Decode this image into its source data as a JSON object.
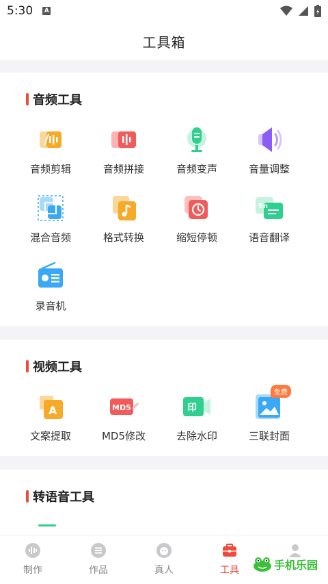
{
  "status": {
    "time": "5:30",
    "indicator": "A"
  },
  "header": {
    "title": "工具箱"
  },
  "sections": [
    {
      "title": "音频工具",
      "tools": [
        {
          "label": "音频剪辑",
          "icon": "audio-cut-icon"
        },
        {
          "label": "音频拼接",
          "icon": "audio-join-icon"
        },
        {
          "label": "音频变声",
          "icon": "voice-change-icon"
        },
        {
          "label": "音量调整",
          "icon": "volume-icon"
        },
        {
          "label": "混合音频",
          "icon": "mix-audio-icon"
        },
        {
          "label": "格式转换",
          "icon": "format-convert-icon"
        },
        {
          "label": "缩短停顿",
          "icon": "shorten-pause-icon"
        },
        {
          "label": "语音翻译",
          "icon": "translate-icon"
        },
        {
          "label": "录音机",
          "icon": "radio-recorder-icon"
        }
      ]
    },
    {
      "title": "视频工具",
      "tools": [
        {
          "label": "文案提取",
          "icon": "text-extract-icon"
        },
        {
          "label": "MD5修改",
          "icon": "md5-edit-icon"
        },
        {
          "label": "去除水印",
          "icon": "remove-watermark-icon"
        },
        {
          "label": "三联封面",
          "icon": "cover-image-icon",
          "badge": "免费"
        }
      ]
    },
    {
      "title": "转语音工具"
    }
  ],
  "tabbar": {
    "items": [
      {
        "label": "制作",
        "icon": "waveform-icon",
        "active": false
      },
      {
        "label": "作品",
        "icon": "list-icon",
        "active": false
      },
      {
        "label": "真人",
        "icon": "person-face-icon",
        "active": false
      },
      {
        "label": "工具",
        "icon": "toolbox-icon",
        "active": true
      },
      {
        "label": "",
        "icon": "profile-icon",
        "active": false
      }
    ]
  },
  "icon_labels": {
    "md5": "MD5",
    "watermark": "印",
    "translate": "En",
    "text_extract": "A"
  },
  "watermark": {
    "text": "手机乐园"
  },
  "colors": {
    "accent": "#f04a3c",
    "orange": "#f7a928",
    "green": "#2fcf8f",
    "purple": "#8b5cf6",
    "blue": "#3aa8f4"
  }
}
